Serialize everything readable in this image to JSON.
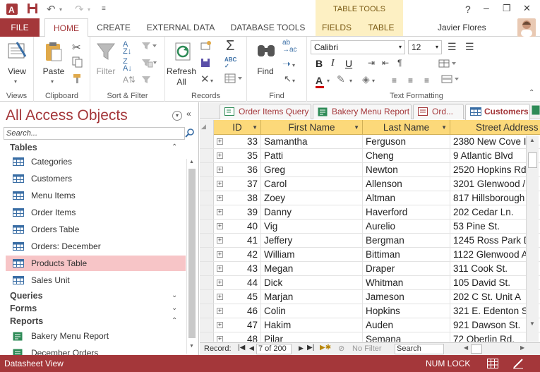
{
  "window": {
    "help": "?",
    "min": "–",
    "restore": "❐",
    "close": "✕",
    "context_tab": "TABLE TOOLS",
    "user_name": "Javier Flores"
  },
  "tabs": [
    "FILE",
    "HOME",
    "CREATE",
    "EXTERNAL DATA",
    "DATABASE TOOLS",
    "FIELDS",
    "TABLE"
  ],
  "ribbon": {
    "groups": [
      "Views",
      "Clipboard",
      "Sort & Filter",
      "Records",
      "Find",
      "Text Formatting"
    ],
    "view_label": "View",
    "paste_label": "Paste",
    "filter_label": "Filter",
    "refresh_label": "Refresh",
    "refresh_label2": "All",
    "find_label": "Find",
    "font_name": "Calibri",
    "font_size": "12"
  },
  "nav": {
    "title": "All Access Objects",
    "search_placeholder": "Search...",
    "sections": {
      "tables": "Tables",
      "queries": "Queries",
      "forms": "Forms",
      "reports": "Reports"
    },
    "tables": [
      "Categories",
      "Customers",
      "Menu Items",
      "Order Items",
      "Orders Table",
      "Orders: December",
      "Products Table",
      "Sales Unit"
    ],
    "selected": "Products Table",
    "reports": [
      "Bakery Menu Report",
      "December Orders"
    ]
  },
  "doc_tabs": [
    "Order Items Query",
    "Bakery Menu Report",
    "Ord...",
    "Customers"
  ],
  "grid": {
    "columns": [
      "ID",
      "First Name",
      "Last Name",
      "Street Address"
    ],
    "rows": [
      [
        "33",
        "Samantha",
        "Ferguson",
        "2380 New Cove I"
      ],
      [
        "35",
        "Patti",
        "Cheng",
        "9 Atlantic Blvd"
      ],
      [
        "36",
        "Greg",
        "Newton",
        "2520 Hopkins Rd"
      ],
      [
        "37",
        "Carol",
        "Allenson",
        "3201 Glenwood /"
      ],
      [
        "38",
        "Zoey",
        "Altman",
        "817 Hillsborough"
      ],
      [
        "39",
        "Danny",
        "Haverford",
        "202 Cedar Ln."
      ],
      [
        "40",
        "Vig",
        "Aurelio",
        "53 Pine St."
      ],
      [
        "41",
        "Jeffery",
        "Bergman",
        "1245 Ross Park D"
      ],
      [
        "42",
        "William",
        "Bittiman",
        "1122 Glenwood A"
      ],
      [
        "43",
        "Megan",
        "Draper",
        "311 Cook St."
      ],
      [
        "44",
        "Dick",
        "Whitman",
        "105 David St."
      ],
      [
        "45",
        "Marjan",
        "Jameson",
        "202 C St. Unit A"
      ],
      [
        "46",
        "Colin",
        "Hopkins",
        "321 E. Edenton S"
      ],
      [
        "47",
        "Hakim",
        "Auden",
        "921 Dawson St."
      ],
      [
        "48",
        "Pilar",
        "Semana",
        "72 Oberlin Rd."
      ]
    ]
  },
  "record_nav": {
    "label": "Record:",
    "current": "7 of 200",
    "filter": "No Filter",
    "search": "Search"
  },
  "status": {
    "view": "Datasheet View",
    "numlock": "NUM LOCK"
  },
  "colors": {
    "accent": "#a4373a",
    "header": "#fcd97a",
    "selected": "#f7c5c7"
  }
}
